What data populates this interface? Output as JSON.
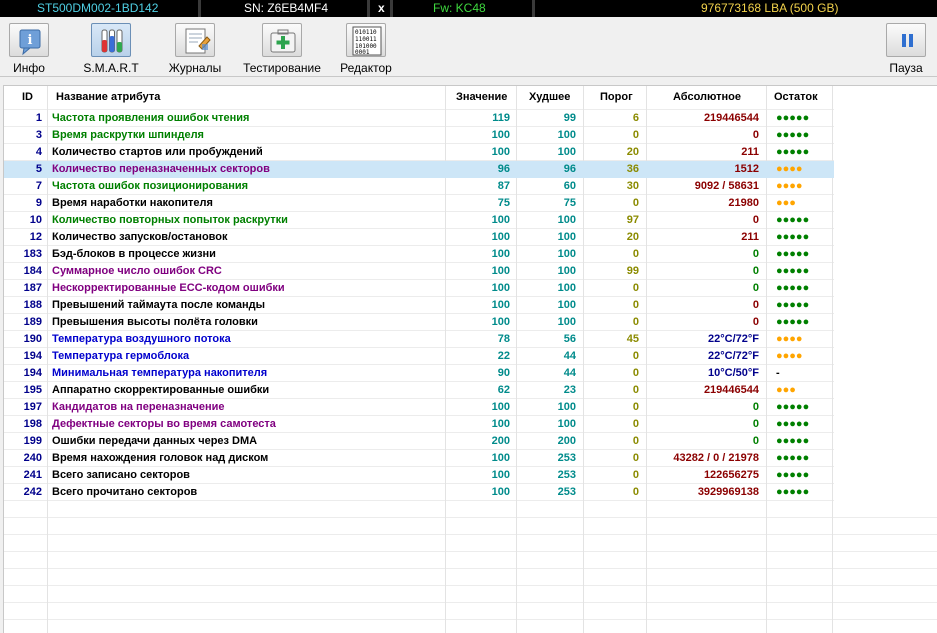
{
  "topbar": {
    "model": "ST500DM002-1BD142",
    "serial": "SN: Z6EB4MF4",
    "close": "x",
    "firmware": "Fw: KC48",
    "capacity": "976773168 LBA (500 GB)"
  },
  "toolbar": {
    "info_label": "Инфо",
    "smart_label": "S.M.A.R.T",
    "logs_label": "Журналы",
    "test_label": "Тестирование",
    "editor_label": "Редактор",
    "pause_label": "Пауза",
    "editor_icon_text": "010110 110011 101000 0001",
    "active": "smart"
  },
  "table": {
    "headers": {
      "id": "ID",
      "name": "Название атрибута",
      "value": "Значение",
      "worst": "Худшее",
      "threshold": "Порог",
      "raw": "Абсолютное",
      "remaining": "Остаток"
    },
    "selected_row_index": 3,
    "colors": {
      "green": "#008000",
      "black": "#000000",
      "purple": "#800080",
      "blue": "#0000cd",
      "raw_red": "#8b0000",
      "raw_green": "#008000",
      "raw_blue": "#00008b",
      "dots_green": "#008000",
      "dots_orange": "#ffa500"
    },
    "rows": [
      {
        "id": "1",
        "name": "Частота проявления ошибок чтения",
        "value": "119",
        "worst": "99",
        "threshold": "6",
        "raw": "219446544",
        "remaining": "●●●●●",
        "name_color": "green",
        "raw_color": "raw_red",
        "dots_color": "dots_green"
      },
      {
        "id": "3",
        "name": "Время раскрутки шпинделя",
        "value": "100",
        "worst": "100",
        "threshold": "0",
        "raw": "0",
        "remaining": "●●●●●",
        "name_color": "green",
        "raw_color": "raw_red",
        "dots_color": "dots_green"
      },
      {
        "id": "4",
        "name": "Количество стартов или пробуждений",
        "value": "100",
        "worst": "100",
        "threshold": "20",
        "raw": "211",
        "remaining": "●●●●●",
        "name_color": "black",
        "raw_color": "raw_red",
        "dots_color": "dots_green"
      },
      {
        "id": "5",
        "name": "Количество переназначенных секторов",
        "value": "96",
        "worst": "96",
        "threshold": "36",
        "raw": "1512",
        "remaining": "●●●●",
        "name_color": "purple",
        "raw_color": "raw_red",
        "dots_color": "dots_orange"
      },
      {
        "id": "7",
        "name": "Частота ошибок позиционирования",
        "value": "87",
        "worst": "60",
        "threshold": "30",
        "raw": "9092 / 58631",
        "remaining": "●●●●",
        "name_color": "green",
        "raw_color": "raw_red",
        "dots_color": "dots_orange"
      },
      {
        "id": "9",
        "name": "Время наработки накопителя",
        "value": "75",
        "worst": "75",
        "threshold": "0",
        "raw": "21980",
        "remaining": "●●●",
        "name_color": "black",
        "raw_color": "raw_red",
        "dots_color": "dots_orange"
      },
      {
        "id": "10",
        "name": "Количество повторных попыток раскрутки",
        "value": "100",
        "worst": "100",
        "threshold": "97",
        "raw": "0",
        "remaining": "●●●●●",
        "name_color": "green",
        "raw_color": "raw_red",
        "dots_color": "dots_green"
      },
      {
        "id": "12",
        "name": "Количество запусков/остановок",
        "value": "100",
        "worst": "100",
        "threshold": "20",
        "raw": "211",
        "remaining": "●●●●●",
        "name_color": "black",
        "raw_color": "raw_red",
        "dots_color": "dots_green"
      },
      {
        "id": "183",
        "name": "Бэд-блоков в процессе жизни",
        "value": "100",
        "worst": "100",
        "threshold": "0",
        "raw": "0",
        "remaining": "●●●●●",
        "name_color": "black",
        "raw_color": "raw_green",
        "dots_color": "dots_green"
      },
      {
        "id": "184",
        "name": "Суммарное число ошибок CRC",
        "value": "100",
        "worst": "100",
        "threshold": "99",
        "raw": "0",
        "remaining": "●●●●●",
        "name_color": "purple",
        "raw_color": "raw_green",
        "dots_color": "dots_green"
      },
      {
        "id": "187",
        "name": "Нескорректированные ECC-кодом ошибки",
        "value": "100",
        "worst": "100",
        "threshold": "0",
        "raw": "0",
        "remaining": "●●●●●",
        "name_color": "purple",
        "raw_color": "raw_green",
        "dots_color": "dots_green"
      },
      {
        "id": "188",
        "name": "Превышений таймаута после команды",
        "value": "100",
        "worst": "100",
        "threshold": "0",
        "raw": "0",
        "remaining": "●●●●●",
        "name_color": "black",
        "raw_color": "raw_red",
        "dots_color": "dots_green"
      },
      {
        "id": "189",
        "name": "Превышения высоты полёта головки",
        "value": "100",
        "worst": "100",
        "threshold": "0",
        "raw": "0",
        "remaining": "●●●●●",
        "name_color": "black",
        "raw_color": "raw_red",
        "dots_color": "dots_green"
      },
      {
        "id": "190",
        "name": "Температура воздушного потока",
        "value": "78",
        "worst": "56",
        "threshold": "45",
        "raw": "22°C/72°F",
        "remaining": "●●●●",
        "name_color": "blue",
        "raw_color": "raw_blue",
        "dots_color": "dots_orange"
      },
      {
        "id": "194",
        "name": "Температура гермоблока",
        "value": "22",
        "worst": "44",
        "threshold": "0",
        "raw": "22°C/72°F",
        "remaining": "●●●●",
        "name_color": "blue",
        "raw_color": "raw_blue",
        "dots_color": "dots_orange"
      },
      {
        "id": "194",
        "name": "Минимальная температура накопителя",
        "value": "90",
        "worst": "44",
        "threshold": "0",
        "raw": "10°C/50°F",
        "remaining": "-",
        "name_color": "blue",
        "raw_color": "raw_blue",
        "dots_color": "black"
      },
      {
        "id": "195",
        "name": "Аппаратно скорректированные ошибки",
        "value": "62",
        "worst": "23",
        "threshold": "0",
        "raw": "219446544",
        "remaining": "●●●",
        "name_color": "black",
        "raw_color": "raw_red",
        "dots_color": "dots_orange"
      },
      {
        "id": "197",
        "name": "Кандидатов на переназначение",
        "value": "100",
        "worst": "100",
        "threshold": "0",
        "raw": "0",
        "remaining": "●●●●●",
        "name_color": "purple",
        "raw_color": "raw_green",
        "dots_color": "dots_green"
      },
      {
        "id": "198",
        "name": "Дефектные секторы во время самотеста",
        "value": "100",
        "worst": "100",
        "threshold": "0",
        "raw": "0",
        "remaining": "●●●●●",
        "name_color": "purple",
        "raw_color": "raw_green",
        "dots_color": "dots_green"
      },
      {
        "id": "199",
        "name": "Ошибки передачи данных через DMA",
        "value": "200",
        "worst": "200",
        "threshold": "0",
        "raw": "0",
        "remaining": "●●●●●",
        "name_color": "black",
        "raw_color": "raw_green",
        "dots_color": "dots_green"
      },
      {
        "id": "240",
        "name": "Время нахождения головок над диском",
        "value": "100",
        "worst": "253",
        "threshold": "0",
        "raw": "43282 / 0 / 21978",
        "remaining": "●●●●●",
        "name_color": "black",
        "raw_color": "raw_red",
        "dots_color": "dots_green"
      },
      {
        "id": "241",
        "name": "Всего записано секторов",
        "value": "100",
        "worst": "253",
        "threshold": "0",
        "raw": "122656275",
        "remaining": "●●●●●",
        "name_color": "black",
        "raw_color": "raw_red",
        "dots_color": "dots_green"
      },
      {
        "id": "242",
        "name": "Всего прочитано секторов",
        "value": "100",
        "worst": "253",
        "threshold": "0",
        "raw": "3929969138",
        "remaining": "●●●●●",
        "name_color": "black",
        "raw_color": "raw_red",
        "dots_color": "dots_green"
      }
    ]
  }
}
